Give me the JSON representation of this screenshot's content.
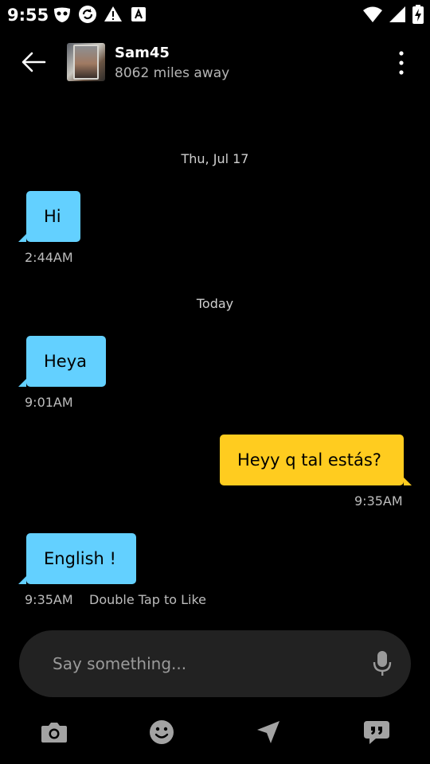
{
  "status_bar": {
    "time": "9:55"
  },
  "header": {
    "back_icon": "arrow-left-icon",
    "name": "Sam45",
    "distance": "8062 miles away",
    "more_icon": "more-vertical-icon"
  },
  "conversation": {
    "date_1": "Thu, Jul 17",
    "date_2": "Today",
    "messages": [
      {
        "text": "Hi",
        "time": "2:44AM",
        "direction": "incoming"
      },
      {
        "text": "Heya",
        "time": "9:01AM",
        "direction": "incoming"
      },
      {
        "text": "Heyy q tal estás?",
        "time": "9:35AM",
        "direction": "outgoing"
      },
      {
        "text": "English !",
        "time": "9:35AM",
        "direction": "incoming",
        "hint": "Double Tap to Like"
      }
    ]
  },
  "composer": {
    "placeholder": "Say something...",
    "mic_icon": "microphone-icon"
  },
  "actions": [
    "camera-icon",
    "emoji-icon",
    "location-arrow-icon",
    "saved-phrases-icon"
  ],
  "colors": {
    "incoming_bubble": "#63d0ff",
    "outgoing_bubble": "#ffcc1f",
    "background": "#000000",
    "composer": "#222222"
  }
}
